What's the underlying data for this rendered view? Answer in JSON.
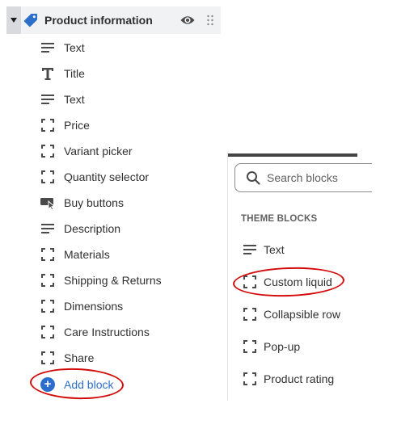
{
  "section": {
    "title": "Product information",
    "icon": "tag-icon",
    "visibility_icon": "eye-icon",
    "drag_icon": "drag-handle-icon"
  },
  "blocks": [
    {
      "label": "Text",
      "icon": "text-lines-icon"
    },
    {
      "label": "Title",
      "icon": "title-t-icon"
    },
    {
      "label": "Text",
      "icon": "text-lines-icon"
    },
    {
      "label": "Price",
      "icon": "dashed-square-icon"
    },
    {
      "label": "Variant picker",
      "icon": "dashed-square-icon"
    },
    {
      "label": "Quantity selector",
      "icon": "dashed-square-icon"
    },
    {
      "label": "Buy buttons",
      "icon": "buy-button-icon"
    },
    {
      "label": "Description",
      "icon": "text-lines-icon"
    },
    {
      "label": "Materials",
      "icon": "dashed-square-icon"
    },
    {
      "label": "Shipping & Returns",
      "icon": "dashed-square-icon"
    },
    {
      "label": "Dimensions",
      "icon": "dashed-square-icon"
    },
    {
      "label": "Care Instructions",
      "icon": "dashed-square-icon"
    },
    {
      "label": "Share",
      "icon": "dashed-square-icon"
    }
  ],
  "add_block": {
    "label": "Add block",
    "icon": "plus-circle-icon"
  },
  "picker": {
    "search_placeholder": "Search blocks",
    "group_heading": "THEME BLOCKS",
    "items": [
      {
        "label": "Text",
        "icon": "text-lines-icon"
      },
      {
        "label": "Custom liquid",
        "icon": "dashed-square-icon"
      },
      {
        "label": "Collapsible row",
        "icon": "dashed-square-icon"
      },
      {
        "label": "Pop-up",
        "icon": "dashed-square-icon"
      },
      {
        "label": "Product rating",
        "icon": "dashed-square-icon"
      }
    ]
  },
  "colors": {
    "accent": "#2c6ecb",
    "annotation": "#d40b0b",
    "header_bg": "#f1f2f4"
  }
}
